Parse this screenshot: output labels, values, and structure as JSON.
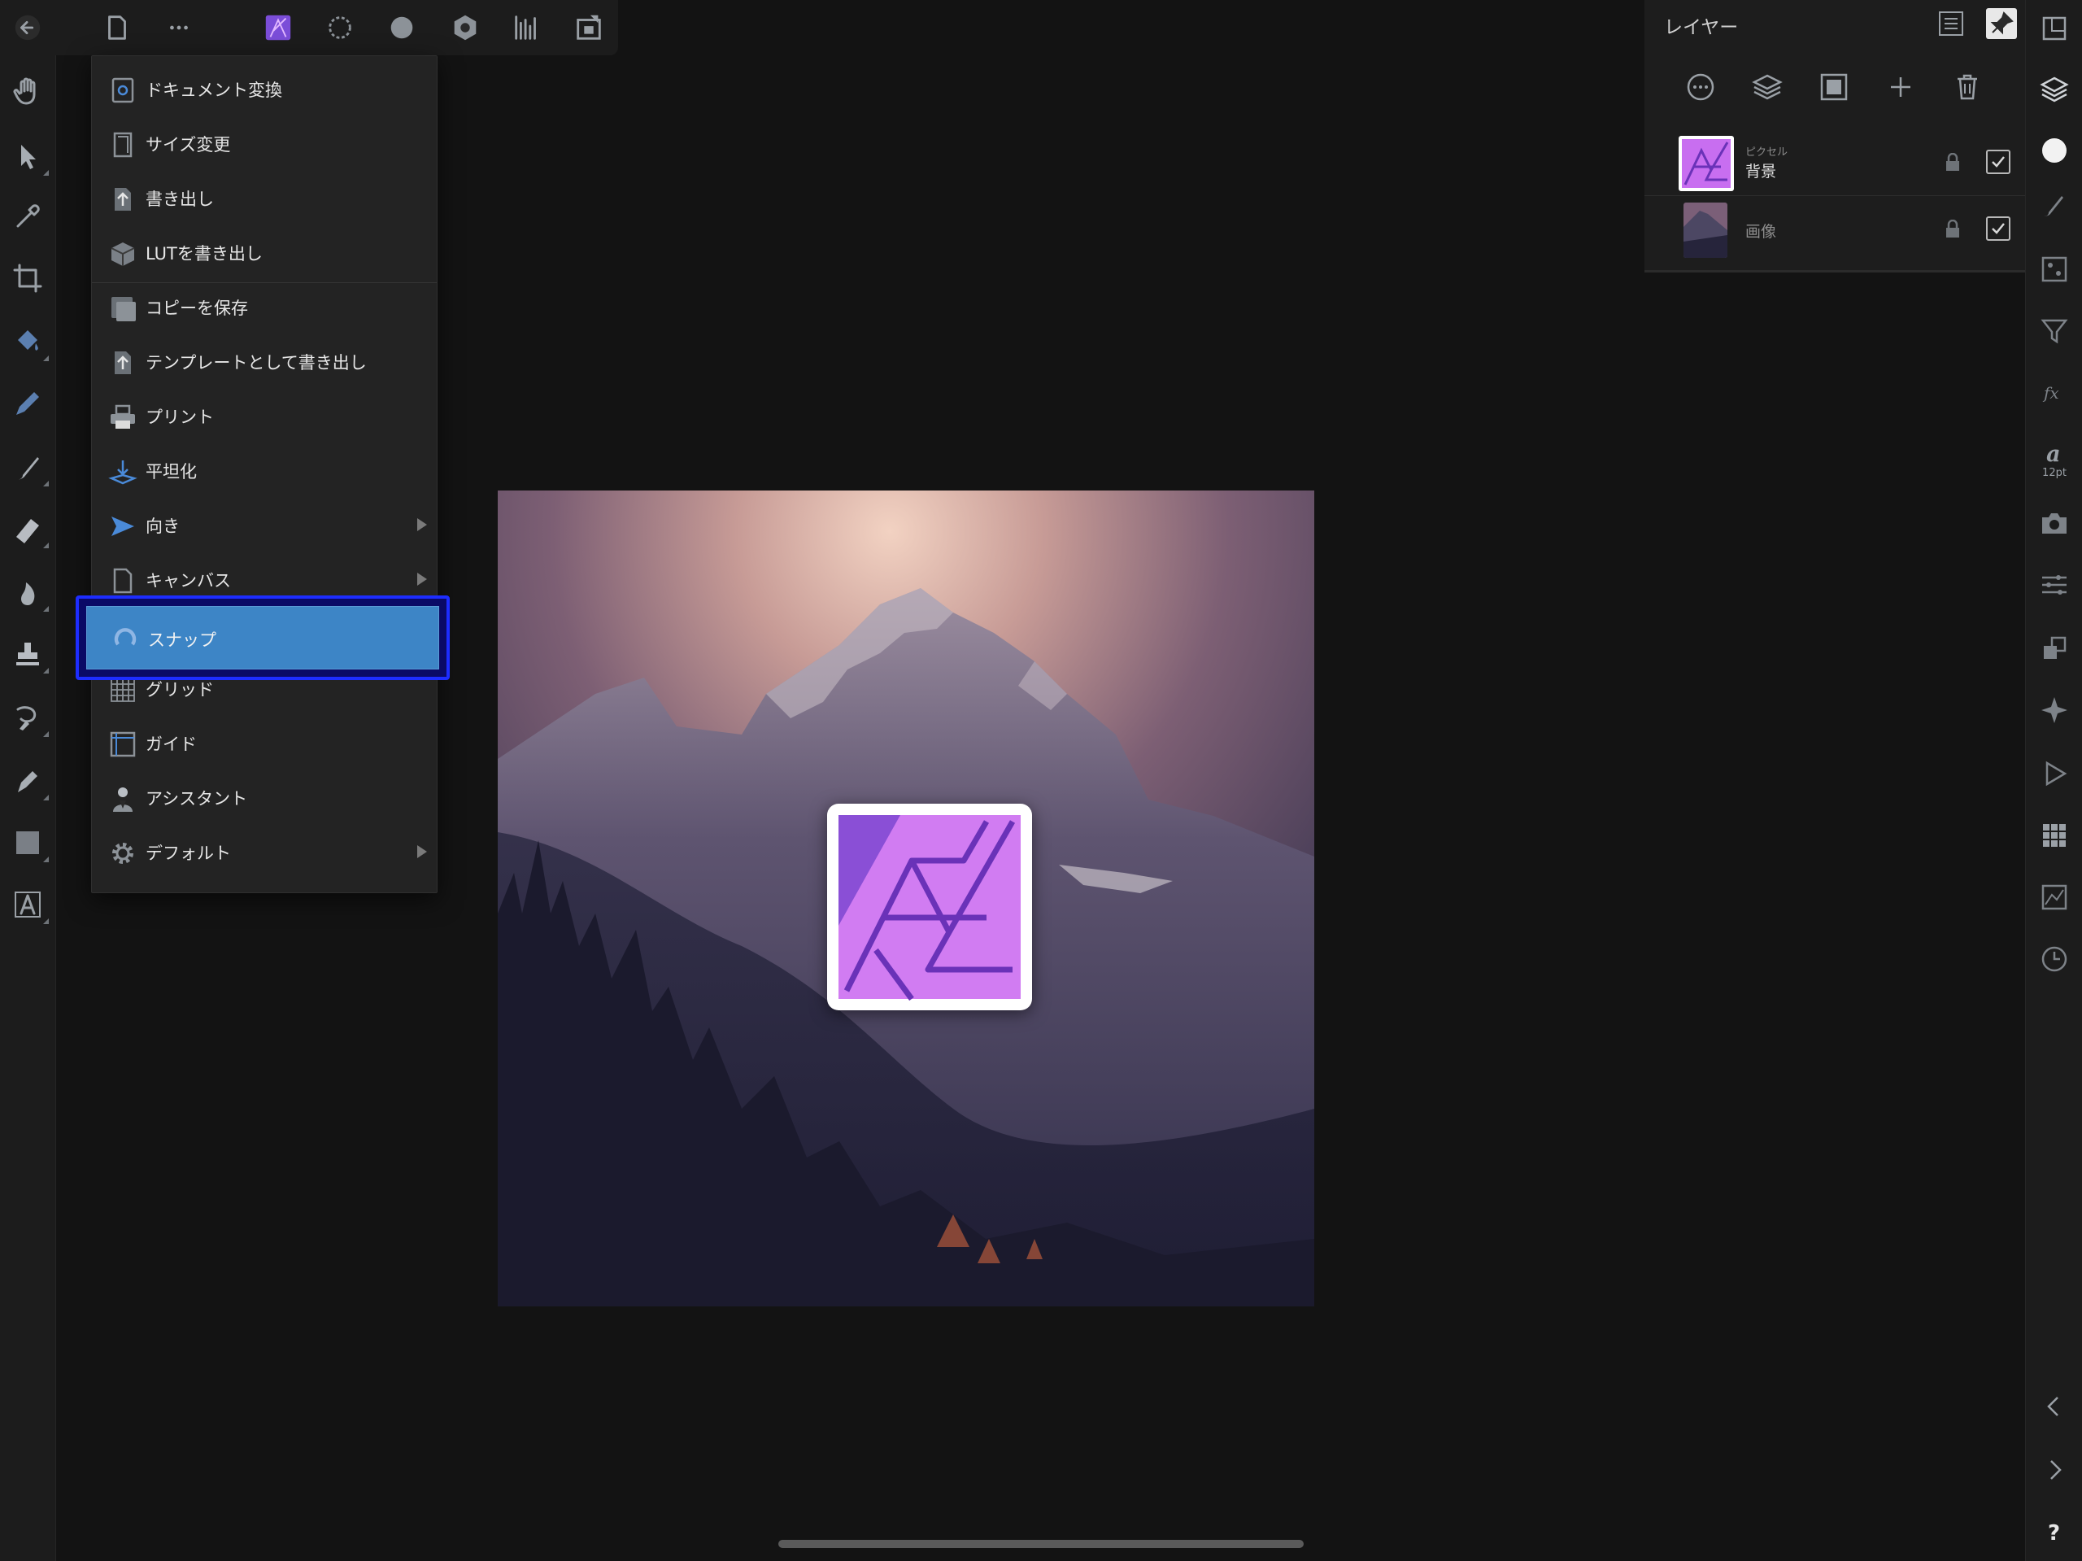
{
  "toolbar": {
    "icons": [
      "back-arrow-icon",
      "document-icon",
      "more-icon",
      "photo-persona-icon",
      "liquify-persona-icon",
      "develop-persona-icon",
      "tone-mapping-persona-icon",
      "levels-icon",
      "export-persona-icon"
    ]
  },
  "left_tools": [
    "hand-tool",
    "move-tool",
    "color-picker-tool",
    "crop-tool",
    "flood-fill-tool",
    "pen-tool",
    "paint-brush-tool",
    "eraser-tool",
    "burn-tool",
    "clone-stamp-tool",
    "selection-brush-tool",
    "vector-pen-tool",
    "rectangle-tool",
    "text-tool"
  ],
  "document_menu": {
    "items": [
      {
        "label": "ドキュメント変換",
        "icon": "document-convert-icon"
      },
      {
        "label": "サイズ変更",
        "icon": "resize-icon"
      },
      {
        "label": "書き出し",
        "icon": "export-icon"
      },
      {
        "label": "LUTを書き出し",
        "icon": "lut-cube-icon"
      },
      {
        "label": "コピーを保存",
        "icon": "save-copy-icon"
      },
      {
        "label": "テンプレートとして書き出し",
        "icon": "template-icon"
      },
      {
        "label": "プリント",
        "icon": "printer-icon"
      },
      {
        "label": "平坦化",
        "icon": "flatten-icon"
      },
      {
        "label": "向き",
        "icon": "orientation-icon",
        "submenu": true
      },
      {
        "label": "キャンバス",
        "icon": "canvas-icon",
        "submenu": true
      },
      {
        "label": "スナップ",
        "icon": "snap-magnet-icon",
        "selected": true
      },
      {
        "label": "グリッド",
        "icon": "grid-icon"
      },
      {
        "label": "ガイド",
        "icon": "guides-icon"
      },
      {
        "label": "アシスタント",
        "icon": "assistant-icon"
      },
      {
        "label": "デフォルト",
        "icon": "gear-icon",
        "submenu": true
      }
    ]
  },
  "layers_panel": {
    "title": "レイヤー",
    "layers": [
      {
        "type": "ピクセル",
        "name": "背景",
        "visible": true
      },
      {
        "type": "",
        "name": "画像",
        "visible": true
      }
    ]
  },
  "right_studio": {
    "text_size": "12pt"
  },
  "colors": {
    "accent": "#3d85c6",
    "highlight_border": "#1d2dff",
    "logo_purple": "#c86ef0"
  }
}
